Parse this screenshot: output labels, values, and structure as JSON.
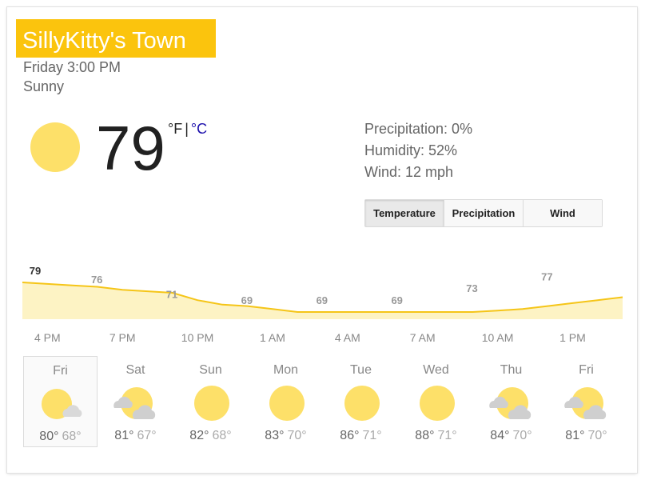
{
  "location": "SillyKitty's Town",
  "datetime": "Friday 3:00 PM",
  "condition": "Sunny",
  "current": {
    "temp": "79",
    "unit_f": "°F",
    "unit_sep": "|",
    "unit_c": "°C"
  },
  "details": {
    "precipitation": "Precipitation: 0%",
    "humidity": "Humidity: 52%",
    "wind": "Wind: 12 mph"
  },
  "tabs": [
    "Temperature",
    "Precipitation",
    "Wind"
  ],
  "active_tab": "Temperature",
  "colors": {
    "accent": "#fbc40d",
    "sun": "#fde069",
    "line": "#f5c518",
    "fill": "#fdf3c4",
    "link": "#1a0dab"
  },
  "chart_data": {
    "type": "area",
    "x_labels": [
      "4 PM",
      "7 PM",
      "10 PM",
      "1 AM",
      "4 AM",
      "7 AM",
      "10 AM",
      "1 PM"
    ],
    "label_values": [
      79,
      76,
      71,
      69,
      69,
      69,
      73,
      77
    ],
    "hours": [
      15,
      16,
      17,
      18,
      19,
      20,
      21,
      22,
      23,
      24,
      25,
      26,
      27,
      28,
      29,
      30,
      31,
      32,
      33,
      34,
      35,
      36,
      37,
      38,
      39
    ],
    "temps": [
      79,
      78.5,
      78,
      77.5,
      76.5,
      76,
      75.5,
      73,
      71.5,
      71,
      70,
      69,
      69,
      69,
      69,
      69,
      69,
      69,
      69,
      69.5,
      70,
      71,
      72,
      73,
      74
    ],
    "ylim": [
      67,
      82
    ]
  },
  "days": [
    {
      "name": "Fri",
      "icon": "sun-cloud-icon",
      "hi": "80°",
      "lo": "68°",
      "selected": true
    },
    {
      "name": "Sat",
      "icon": "partly-cloudy-icon",
      "hi": "81°",
      "lo": "67°"
    },
    {
      "name": "Sun",
      "icon": "sun-icon",
      "hi": "82°",
      "lo": "68°"
    },
    {
      "name": "Mon",
      "icon": "sun-icon",
      "hi": "83°",
      "lo": "70°"
    },
    {
      "name": "Tue",
      "icon": "sun-icon",
      "hi": "86°",
      "lo": "71°"
    },
    {
      "name": "Wed",
      "icon": "sun-icon",
      "hi": "88°",
      "lo": "71°"
    },
    {
      "name": "Thu",
      "icon": "partly-cloudy-icon",
      "hi": "84°",
      "lo": "70°"
    },
    {
      "name": "Fri",
      "icon": "partly-cloudy-icon",
      "hi": "81°",
      "lo": "70°"
    }
  ]
}
